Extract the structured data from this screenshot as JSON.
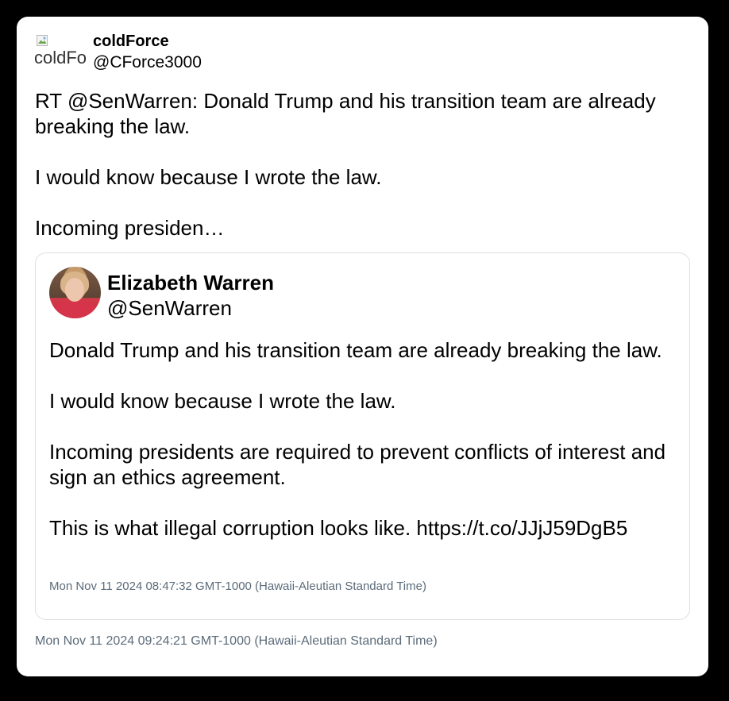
{
  "tweet": {
    "user_name": "coldForce",
    "user_handle": "@CForce3000",
    "avatar_alt": "coldForce",
    "text_paragraphs": [
      "RT @SenWarren: Donald Trump and his transition team are already breaking the law.",
      "I would know because I wrote the law.",
      "Incoming presiden…"
    ],
    "timestamp": "Mon Nov 11 2024 09:24:21 GMT-1000 (Hawaii-Aleutian Standard Time)"
  },
  "quoted_tweet": {
    "user_name": "Elizabeth Warren",
    "user_handle": "@SenWarren",
    "text_paragraphs": [
      "Donald Trump and his transition team are already breaking the law.",
      "I would know because I wrote the law.",
      "Incoming presidents are required to prevent conflicts of interest and sign an ethics agreement.",
      "This is what illegal corruption looks like. https://t.co/JJjJ59DgB5"
    ],
    "timestamp": "Mon Nov 11 2024 08:47:32 GMT-1000 (Hawaii-Aleutian Standard Time)"
  },
  "colors": {
    "background": "#000000",
    "card": "#ffffff",
    "timestamp_text": "#5b6b7a",
    "quote_border": "#dcdfe3"
  }
}
